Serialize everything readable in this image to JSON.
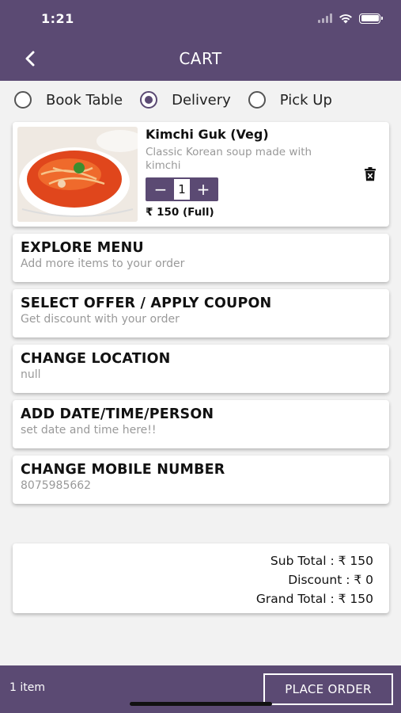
{
  "status": {
    "time": "1:21"
  },
  "header": {
    "title": "CART"
  },
  "order_modes": [
    {
      "label": "Book Table",
      "selected": false
    },
    {
      "label": "Delivery",
      "selected": true
    },
    {
      "label": "Pick Up",
      "selected": false
    }
  ],
  "cart_item": {
    "name": "Kimchi Guk (Veg)",
    "description": "Classic Korean soup made with kimchi",
    "quantity": "1",
    "decrement": "−",
    "increment": "+",
    "price": "₹ 150 (Full)"
  },
  "options": [
    {
      "title": "EXPLORE MENU",
      "subtitle": "Add more items to your order"
    },
    {
      "title": "SELECT OFFER / APPLY COUPON",
      "subtitle": "Get discount with your order"
    },
    {
      "title": "CHANGE LOCATION",
      "subtitle": "null"
    },
    {
      "title": "ADD DATE/TIME/PERSON",
      "subtitle": "set date and time here!!"
    },
    {
      "title": "CHANGE MOBILE NUMBER",
      "subtitle": "8075985662"
    }
  ],
  "totals": {
    "sub_total": "Sub Total :  ₹ 150",
    "discount": "Discount :  ₹ 0",
    "grand_total": "Grand Total :  ₹ 150"
  },
  "footer": {
    "item_count": "1 item",
    "place_order": "PLACE ORDER"
  },
  "colors": {
    "primary": "#5b4a73",
    "background": "#f2f2f2"
  }
}
